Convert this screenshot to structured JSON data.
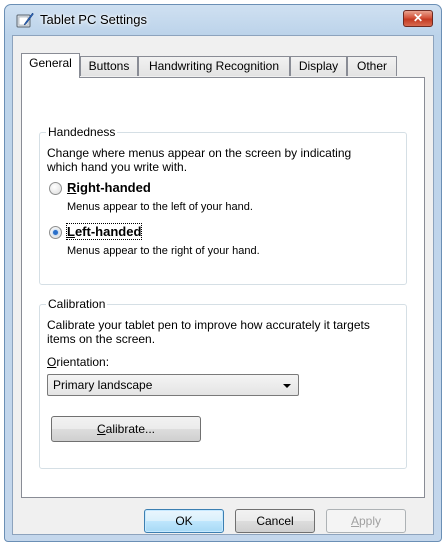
{
  "window": {
    "title": "Tablet PC Settings",
    "close_label": "✕"
  },
  "tabs": [
    {
      "label": "General"
    },
    {
      "label": "Buttons"
    },
    {
      "label": "Handwriting Recognition"
    },
    {
      "label": "Display"
    },
    {
      "label": "Other"
    }
  ],
  "handedness": {
    "group_label": "Handedness",
    "description_line1": "Change where menus appear on the screen by indicating",
    "description_line2": "which hand you write with.",
    "right": {
      "mnemonic": "R",
      "label_rest": "ight-handed",
      "hint": "Menus appear to the left of your hand.",
      "checked": false
    },
    "left": {
      "mnemonic": "L",
      "label_rest": "eft-handed",
      "hint": "Menus appear to the right of your hand.",
      "checked": true
    }
  },
  "calibration": {
    "group_label": "Calibration",
    "description_line1": "Calibrate your tablet pen to improve how accurately it targets",
    "description_line2": "items on the screen.",
    "orientation_mnemonic": "O",
    "orientation_rest": "rientation:",
    "orientation_value": "Primary landscape",
    "calibrate_mnemonic": "C",
    "calibrate_rest": "alibrate..."
  },
  "buttons": {
    "ok": "OK",
    "cancel": "Cancel",
    "apply_mnemonic": "A",
    "apply_rest": "pply"
  }
}
